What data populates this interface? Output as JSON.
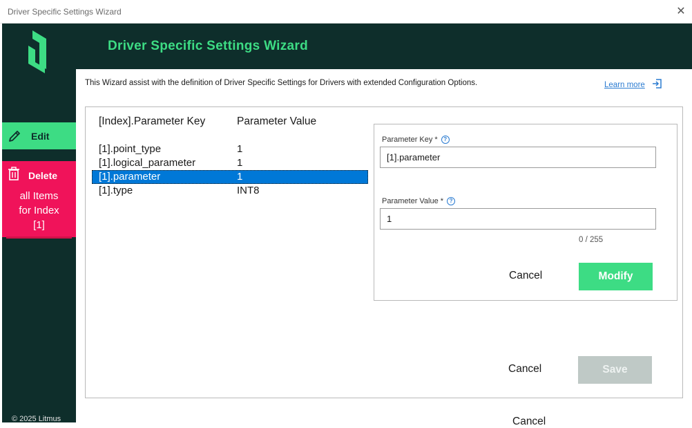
{
  "window": {
    "title": "Driver Specific Settings Wizard",
    "close_glyph": "✕"
  },
  "sidebar": {
    "edit_label": "Edit",
    "delete_label": "Delete",
    "delete_lines": [
      "all Items",
      "for Index",
      "[1]"
    ],
    "copyright": "© 2025 Litmus"
  },
  "header": {
    "title": "Driver Specific Settings Wizard"
  },
  "description": "This Wizard assist with the definition of Driver Specific Settings for Drivers with extended Configuration Options.",
  "learn_more": "Learn more",
  "table": {
    "col_key": "[Index].Parameter Key",
    "col_value": "Parameter Value",
    "rows": [
      {
        "key": "[1].point_type",
        "value": "1"
      },
      {
        "key": "[1].logical_parameter",
        "value": "1"
      },
      {
        "key": "[1].parameter",
        "value": "1"
      },
      {
        "key": "[1].type",
        "value": "INT8"
      }
    ],
    "selected_index": 2
  },
  "form": {
    "key_label": "Parameter Key *",
    "key_value": "[1].parameter",
    "value_label": "Parameter Value *",
    "value_value": "1",
    "counter": "0 / 255",
    "cancel_label": "Cancel",
    "modify_label": "Modify"
  },
  "footer": {
    "cancel_label": "Cancel",
    "save_label": "Save",
    "cancel_cut_label": "Cancel"
  },
  "colors": {
    "dark": "#0e2e2b",
    "green": "#3ddc84",
    "red": "#f0135a",
    "selection": "#0078d7"
  }
}
